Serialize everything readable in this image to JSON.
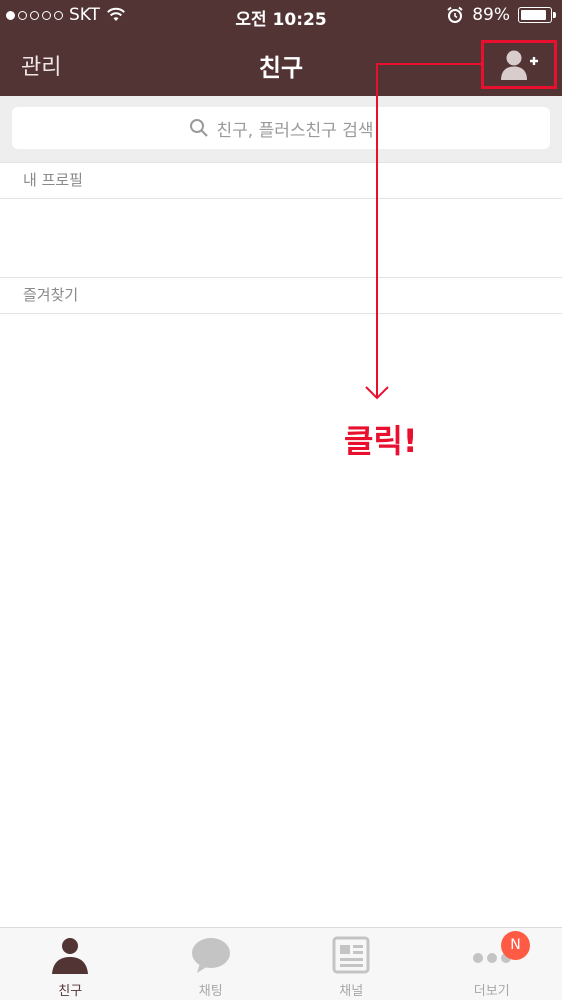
{
  "status_bar": {
    "carrier": "SKT",
    "time": "오전 10:25",
    "battery": "89%",
    "battery_level": 0.89,
    "signal_bars_filled": 1,
    "signal_bars_total": 5
  },
  "nav": {
    "left_label": "관리",
    "title": "친구",
    "add_friend_icon": "add-friend-icon"
  },
  "search": {
    "placeholder": "친구, 플러스친구 검색",
    "icon": "search-icon"
  },
  "sections": {
    "my_profile": "내 프로필",
    "favorites": "즐겨찾기"
  },
  "annotation": {
    "text": "클릭!",
    "color": "#e8102e"
  },
  "tabs": [
    {
      "label": "친구",
      "icon": "person-icon",
      "active": true
    },
    {
      "label": "채팅",
      "icon": "chat-bubble-icon",
      "active": false
    },
    {
      "label": "채널",
      "icon": "channel-icon",
      "active": false
    },
    {
      "label": "더보기",
      "icon": "more-dots-icon",
      "active": false
    }
  ],
  "more_badge": "N",
  "colors": {
    "header_bg": "#523434",
    "accent_red": "#e8102e",
    "badge": "#ff5a43"
  }
}
